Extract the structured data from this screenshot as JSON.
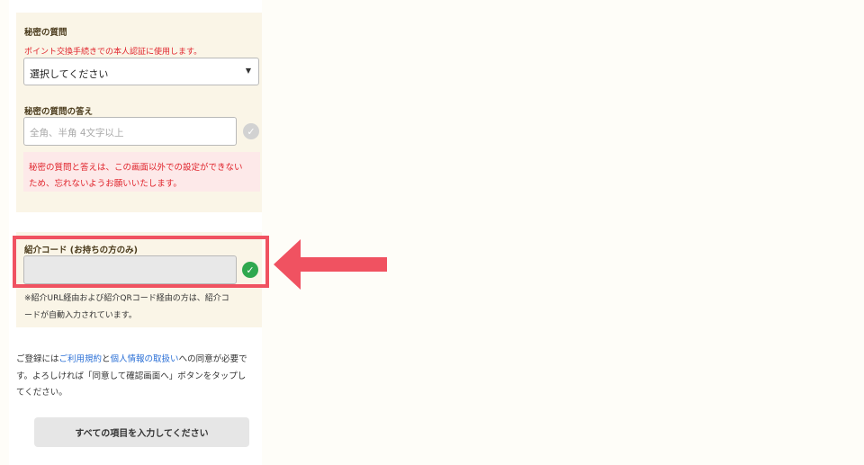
{
  "secret_question": {
    "label": "秘密の質問",
    "note": "ポイント交換手続きでの本人認証に使用します。",
    "select_value": "選択してください",
    "caret": "▼"
  },
  "secret_answer": {
    "label": "秘密の質問の答え",
    "placeholder": "全角、半角 4文字以上",
    "check": "✓",
    "warning_line1": "秘密の質問と答えは、この画面以外での設定ができない",
    "warning_line2": "ため、忘れないようお願いいたします。"
  },
  "referral": {
    "label": "紹介コード (お持ちの方のみ)",
    "check": "✓",
    "note_line1": "※紹介URL経由および紹介QRコード経由の方は、紹介コ",
    "note_line2": "ードが自動入力されています。"
  },
  "consent": {
    "line1_pre": "ご登録には",
    "terms_link": "ご利用規約",
    "and": "と",
    "privacy_link": "個人情報の取扱い",
    "line1_post": "への同意が必要で",
    "line2": "す。よろしければ「同意して確認画面へ」ボタンをタップし",
    "line3": "てください。"
  },
  "submit": {
    "label": "すべての項目を入力してください"
  },
  "colors": {
    "highlight": "#f05261",
    "check_valid": "#2fa84f",
    "check_idle": "#d2d2d2",
    "warning_text": "#e0242c",
    "link": "#2a6fd6"
  }
}
